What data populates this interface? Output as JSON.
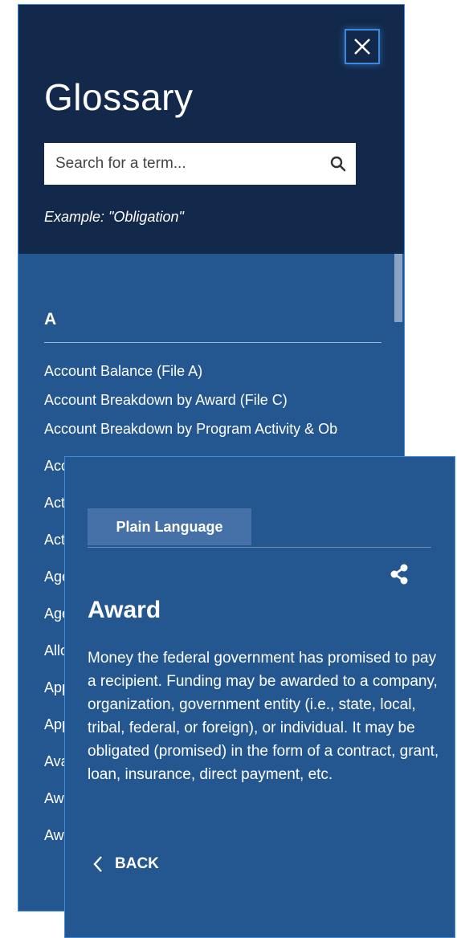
{
  "glossary": {
    "title": "Glossary",
    "search_placeholder": "Search for a term...",
    "example": "Example: \"Obligation\"",
    "letter": "A",
    "terms": [
      "Account Balance (File A)",
      "Account Breakdown by Award (File C)",
      "Account Breakdown by Program Activity & Ob",
      "Acc",
      "Act",
      "Act",
      "Age",
      "Age",
      "Allo",
      "App",
      "App",
      "Ava",
      "Aw",
      "Aw"
    ]
  },
  "definition": {
    "tab_label": "Plain Language",
    "term": "Award",
    "text": "Money the federal government has promised to pay a recipient. Funding may be awarded to a company, organization, government entity (i.e., state, local, tribal, federal, or foreign), or individual. It may be obligated (promised) in the form of a contract, grant, loan, insurance, direct payment, etc.",
    "back_label": "BACK"
  },
  "icons": {
    "close": "close-icon",
    "search": "search-icon",
    "share": "share-icon",
    "back": "chevron-left-icon"
  },
  "colors": {
    "header_bg": "#13294b",
    "panel_bg": "#24568f",
    "accent": "#3b8ae0"
  }
}
